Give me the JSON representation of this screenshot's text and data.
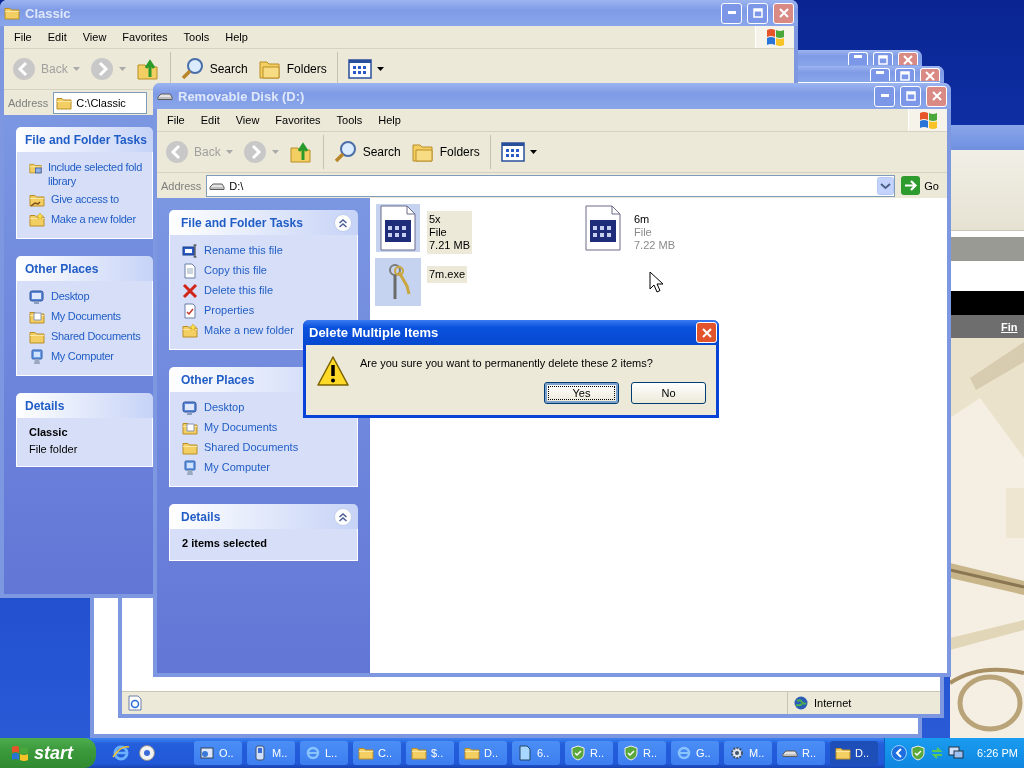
{
  "background_browser": {
    "link": "Fin"
  },
  "browser_window": {
    "status_bar": {
      "zone": "Internet"
    }
  },
  "classic_window": {
    "title": "Classic",
    "menu": [
      "File",
      "Edit",
      "View",
      "Favorites",
      "Tools",
      "Help"
    ],
    "toolbar": {
      "back": {
        "label": "Back",
        "disabled": true
      },
      "search": "Search",
      "folders": "Folders"
    },
    "address": {
      "label": "Address",
      "value": "C:\\Classic"
    },
    "panels": [
      {
        "kind": "tasks",
        "title": "File and Folder Tasks",
        "items": [
          {
            "kind": "include",
            "text": "Include selected fold\nlibrary"
          },
          {
            "kind": "share",
            "text": "Give access to"
          },
          {
            "kind": "newfolder",
            "text": "Make a new folder"
          }
        ]
      },
      {
        "kind": "tasks",
        "title": "Other Places",
        "items": [
          {
            "kind": "desktop",
            "text": "Desktop"
          },
          {
            "kind": "documents",
            "text": "My Documents"
          },
          {
            "kind": "shared",
            "text": "Shared Documents"
          },
          {
            "kind": "computer",
            "text": "My Computer"
          }
        ]
      },
      {
        "kind": "details",
        "title": "Details",
        "lines": [
          {
            "text": "Classic",
            "bold": true
          },
          {
            "text": "File folder",
            "bold": false
          }
        ]
      }
    ]
  },
  "removable_window": {
    "title": "Removable Disk (D:)",
    "menu": [
      "File",
      "Edit",
      "View",
      "Favorites",
      "Tools",
      "Help"
    ],
    "toolbar": {
      "back": {
        "label": "Back",
        "disabled": true
      },
      "search": "Search",
      "folders": "Folders"
    },
    "address": {
      "label": "Address",
      "value": "D:\\",
      "go": "Go"
    },
    "panels": [
      {
        "kind": "tasks",
        "title": "File and Folder Tasks",
        "chevron": true,
        "items": [
          {
            "kind": "rename",
            "text": "Rename this file"
          },
          {
            "kind": "copy",
            "text": "Copy this file"
          },
          {
            "kind": "delete",
            "text": "Delete this file"
          },
          {
            "kind": "properties",
            "text": "Properties"
          },
          {
            "kind": "newfolder",
            "text": "Make a new folder"
          }
        ]
      },
      {
        "kind": "tasks",
        "title": "Other Places",
        "items": [
          {
            "kind": "desktop",
            "text": "Desktop"
          },
          {
            "kind": "documents",
            "text": "My Documents"
          },
          {
            "kind": "shared",
            "text": "Shared Documents"
          },
          {
            "kind": "computer",
            "text": "My Computer"
          }
        ]
      },
      {
        "kind": "details",
        "title": "Details",
        "chevron": true,
        "lines": [
          {
            "text": "2 items selected",
            "bold": true
          }
        ]
      }
    ],
    "files": [
      {
        "kind": "document",
        "name": "5x",
        "type": "File",
        "size": "7.21 MB",
        "selected": true
      },
      {
        "kind": "document",
        "name": "6m",
        "type": "File",
        "size": "7.22 MB",
        "selected": false
      },
      {
        "kind": "program",
        "name": "7m.exe",
        "selected": true
      }
    ]
  },
  "dialog": {
    "title": "Delete Multiple Items",
    "message": "Are you sure you want to permanently delete these 2 items?",
    "buttons": [
      {
        "label": "Yes",
        "default": true
      },
      {
        "label": "No",
        "default": false
      }
    ]
  },
  "taskbar": {
    "start": "start",
    "tasks": [
      {
        "kind": "window",
        "label": "O..",
        "selected": false
      },
      {
        "kind": "setup",
        "label": "M..",
        "selected": false
      },
      {
        "kind": "browser",
        "label": "L..",
        "selected": false
      },
      {
        "kind": "folder",
        "label": "C..",
        "selected": false
      },
      {
        "kind": "folder",
        "label": "$..",
        "selected": false
      },
      {
        "kind": "folder",
        "label": "D..",
        "selected": false
      },
      {
        "kind": "document",
        "label": "6..",
        "selected": false
      },
      {
        "kind": "shield",
        "label": "R..",
        "selected": false
      },
      {
        "kind": "shield",
        "label": "R..",
        "selected": false
      },
      {
        "kind": "browser",
        "label": "G..",
        "selected": false
      },
      {
        "kind": "gear",
        "label": "M..",
        "selected": false
      },
      {
        "kind": "drive",
        "label": "R..",
        "selected": false
      },
      {
        "kind": "folder",
        "label": "D..",
        "selected": true
      }
    ],
    "clock": "6:26 PM"
  }
}
